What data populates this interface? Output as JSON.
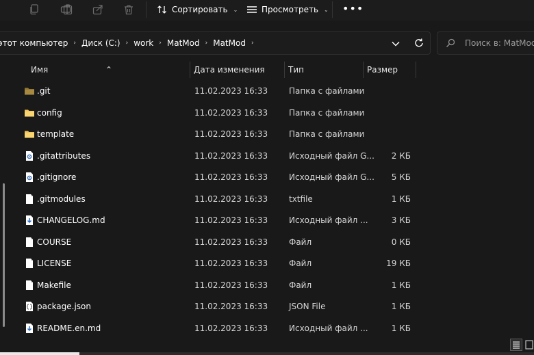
{
  "toolbar": {
    "sort_label": "Сортировать",
    "view_label": "Просмотреть",
    "more_label": "•••",
    "icons": [
      "copy-icon",
      "paste-icon",
      "rename-icon",
      "share-icon",
      "delete-icon"
    ]
  },
  "address": {
    "crumbs": [
      "этот компьютер",
      "Диск (C:)",
      "work",
      "MatMod",
      "MatMod"
    ],
    "crumb_separator": "›"
  },
  "search": {
    "placeholder": "Поиск в: MatMod"
  },
  "columns": {
    "name": "Имя",
    "date": "Дата изменения",
    "type": "Тип",
    "size": "Размер"
  },
  "files": [
    {
      "name": ".git",
      "date": "11.02.2023 16:33",
      "type": "Папка с файлами",
      "size": "",
      "icon": "folder-dark-icon"
    },
    {
      "name": "config",
      "date": "11.02.2023 16:33",
      "type": "Папка с файлами",
      "size": "",
      "icon": "folder-icon"
    },
    {
      "name": "template",
      "date": "11.02.2023 16:33",
      "type": "Папка с файлами",
      "size": "",
      "icon": "folder-icon"
    },
    {
      "name": ".gitattributes",
      "date": "11.02.2023 16:33",
      "type": "Исходный файл G...",
      "size": "2 КБ",
      "icon": "settings-file-icon"
    },
    {
      "name": ".gitignore",
      "date": "11.02.2023 16:33",
      "type": "Исходный файл G...",
      "size": "5 КБ",
      "icon": "settings-file-icon"
    },
    {
      "name": ".gitmodules",
      "date": "11.02.2023 16:33",
      "type": "txtfile",
      "size": "1 КБ",
      "icon": "file-icon"
    },
    {
      "name": "CHANGELOG.md",
      "date": "11.02.2023 16:33",
      "type": "Исходный файл ...",
      "size": "3 КБ",
      "icon": "markdown-file-icon"
    },
    {
      "name": "COURSE",
      "date": "11.02.2023 16:33",
      "type": "Файл",
      "size": "0 КБ",
      "icon": "file-icon"
    },
    {
      "name": "LICENSE",
      "date": "11.02.2023 16:33",
      "type": "Файл",
      "size": "19 КБ",
      "icon": "file-icon"
    },
    {
      "name": "Makefile",
      "date": "11.02.2023 16:33",
      "type": "Файл",
      "size": "1 КБ",
      "icon": "file-icon"
    },
    {
      "name": "package.json",
      "date": "11.02.2023 16:33",
      "type": "JSON File",
      "size": "1 КБ",
      "icon": "json-file-icon"
    },
    {
      "name": "README.en.md",
      "date": "11.02.2023 16:33",
      "type": "Исходный файл ...",
      "size": "1 КБ",
      "icon": "markdown-file-icon"
    }
  ],
  "colors": {
    "background": "#191919",
    "folder": "#f2c55c",
    "folder_dark": "#a8893f",
    "text": "#ffffff"
  }
}
